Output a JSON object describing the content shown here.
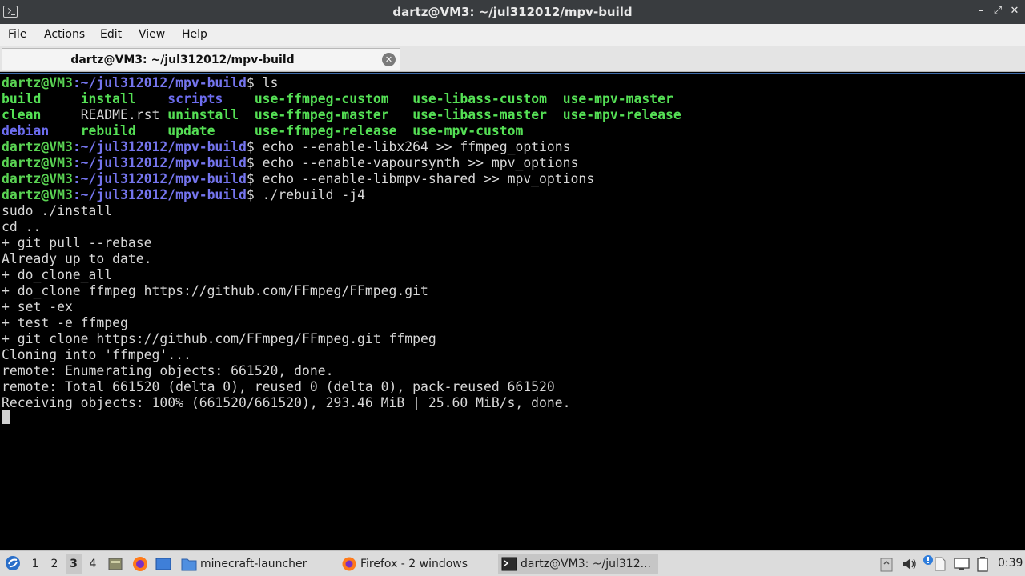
{
  "window": {
    "title": "dartz@VM3: ~/jul312012/mpv-build"
  },
  "menu": {
    "items": [
      "File",
      "Actions",
      "Edit",
      "View",
      "Help"
    ]
  },
  "tab": {
    "label": "dartz@VM3: ~/jul312012/mpv-build"
  },
  "terminal": {
    "prompt_user": "dartz@VM3",
    "prompt_path": ":~/jul312012/mpv-build",
    "prompt_end": "$ ",
    "lines": [
      {
        "type": "cmd",
        "cmd": "ls"
      },
      {
        "type": "ls",
        "cols": [
          {
            "t": "build     ",
            "k": "exec"
          },
          {
            "t": "install    ",
            "k": "exec"
          },
          {
            "t": "scripts    ",
            "k": "dir"
          },
          {
            "t": "use-ffmpeg-custom   ",
            "k": "exec"
          },
          {
            "t": "use-libass-custom  ",
            "k": "exec"
          },
          {
            "t": "use-mpv-master",
            "k": "exec"
          }
        ]
      },
      {
        "type": "ls",
        "cols": [
          {
            "t": "clean     ",
            "k": "exec"
          },
          {
            "t": "README.rst ",
            "k": "file"
          },
          {
            "t": "uninstall  ",
            "k": "exec"
          },
          {
            "t": "use-ffmpeg-master   ",
            "k": "exec"
          },
          {
            "t": "use-libass-master  ",
            "k": "exec"
          },
          {
            "t": "use-mpv-release",
            "k": "exec"
          }
        ]
      },
      {
        "type": "ls",
        "cols": [
          {
            "t": "debian    ",
            "k": "dir"
          },
          {
            "t": "rebuild    ",
            "k": "exec"
          },
          {
            "t": "update     ",
            "k": "exec"
          },
          {
            "t": "use-ffmpeg-release  ",
            "k": "exec"
          },
          {
            "t": "use-mpv-custom",
            "k": "exec"
          }
        ]
      },
      {
        "type": "cmd",
        "cmd": "echo --enable-libx264 >> ffmpeg_options"
      },
      {
        "type": "cmd",
        "cmd": "echo --enable-vapoursynth >> mpv_options"
      },
      {
        "type": "cmd",
        "cmd": "echo --enable-libmpv-shared >> mpv_options"
      },
      {
        "type": "cmd",
        "cmd": "./rebuild -j4"
      },
      {
        "type": "out",
        "text": "sudo ./install"
      },
      {
        "type": "out",
        "text": "cd .."
      },
      {
        "type": "out",
        "text": "+ git pull --rebase"
      },
      {
        "type": "out",
        "text": "Already up to date."
      },
      {
        "type": "out",
        "text": "+ do_clone_all"
      },
      {
        "type": "out",
        "text": "+ do_clone ffmpeg https://github.com/FFmpeg/FFmpeg.git"
      },
      {
        "type": "out",
        "text": "+ set -ex"
      },
      {
        "type": "out",
        "text": "+ test -e ffmpeg"
      },
      {
        "type": "out",
        "text": "+ git clone https://github.com/FFmpeg/FFmpeg.git ffmpeg"
      },
      {
        "type": "out",
        "text": "Cloning into 'ffmpeg'..."
      },
      {
        "type": "out",
        "text": "remote: Enumerating objects: 661520, done."
      },
      {
        "type": "out",
        "text": "remote: Total 661520 (delta 0), reused 0 (delta 0), pack-reused 661520"
      },
      {
        "type": "out",
        "text": "Receiving objects: 100% (661520/661520), 293.46 MiB | 25.60 MiB/s, done."
      }
    ]
  },
  "taskbar": {
    "workspaces": [
      "1",
      "2",
      "3",
      "4"
    ],
    "active_workspace": "3",
    "tasks": [
      {
        "label": "minecraft-launcher",
        "icon": "folder-icon"
      },
      {
        "label": "Firefox - 2 windows",
        "icon": "firefox-icon"
      },
      {
        "label": "dartz@VM3: ~/jul312...",
        "icon": "terminal-icon"
      }
    ],
    "clock": "0:39"
  }
}
